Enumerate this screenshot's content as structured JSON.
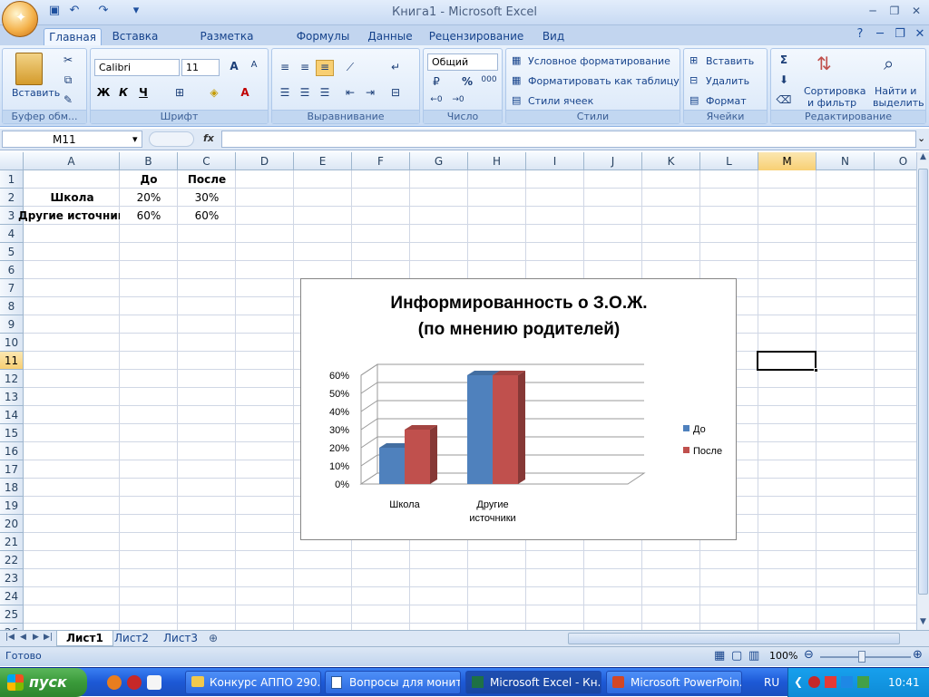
{
  "app": {
    "title": "Книга1 - Microsoft Excel"
  },
  "tabs": [
    "Главная",
    "Вставка",
    "Разметка страницы",
    "Формулы",
    "Данные",
    "Рецензирование",
    "Вид"
  ],
  "ribbon": {
    "clipboard": {
      "label": "Буфер обм...",
      "paste": "Вставить"
    },
    "font": {
      "label": "Шрифт",
      "name": "Calibri",
      "size": "11",
      "bold": "Ж",
      "italic": "К",
      "underline": "Ч",
      "grow": "A",
      "shrink": "A"
    },
    "alignment": {
      "label": "Выравнивание"
    },
    "number": {
      "label": "Число",
      "format": "Общий",
      "percent": "%",
      "thousands": "000"
    },
    "styles": {
      "label": "Стили",
      "conditional": "Условное форматирование",
      "as_table": "Форматировать как таблицу",
      "cell_styles": "Стили ячеек"
    },
    "cells": {
      "label": "Ячейки",
      "insert": "Вставить",
      "delete": "Удалить",
      "format": "Формат"
    },
    "editing": {
      "label": "Редактирование",
      "sort1": "Сортировка",
      "sort2": "и фильтр",
      "find1": "Найти и",
      "find2": "выделить"
    }
  },
  "namebox": "M11",
  "fx": "fx",
  "columns": [
    "A",
    "B",
    "C",
    "D",
    "E",
    "F",
    "G",
    "H",
    "I",
    "J",
    "K",
    "L",
    "M",
    "N",
    "O"
  ],
  "rows": [
    "1",
    "2",
    "3",
    "4",
    "5",
    "6",
    "7",
    "8",
    "9",
    "10",
    "11",
    "12",
    "13",
    "14",
    "15",
    "16",
    "17",
    "18",
    "19",
    "20",
    "21",
    "22",
    "23",
    "24",
    "25",
    "26"
  ],
  "cells": {
    "B1": "До",
    "C1": "После",
    "A2": "Школа",
    "B2": "20%",
    "C2": "30%",
    "A3": "Другие источники",
    "B3": "60%",
    "C3": "60%"
  },
  "chart_data": {
    "type": "bar",
    "title": "Информированность о З.О.Ж.",
    "subtitle": "(по мнению родителей)",
    "categories": [
      "Школа",
      "Другие источники"
    ],
    "category_lines": [
      [
        "Школа"
      ],
      [
        "Другие",
        "источники"
      ]
    ],
    "series": [
      {
        "name": "До",
        "values": [
          20,
          60
        ],
        "color": "#4f81bd"
      },
      {
        "name": "После",
        "values": [
          30,
          60
        ],
        "color": "#c0504d"
      }
    ],
    "yticks": [
      "0%",
      "10%",
      "20%",
      "30%",
      "40%",
      "50%",
      "60%"
    ],
    "ylim": [
      0,
      60
    ],
    "grid": true,
    "legend": "right"
  },
  "sheets": [
    "Лист1",
    "Лист2",
    "Лист3"
  ],
  "status": {
    "ready": "Готово",
    "zoom": "100%"
  },
  "taskbar": {
    "start": "пуск",
    "tasks": [
      "Конкурс АППО 290...",
      "Вопросы для монит...",
      "Microsoft Excel - Кн...",
      "Microsoft PowerPoin..."
    ],
    "lang": "RU",
    "clock": "10:41"
  },
  "colors": {
    "accent": "#15428b",
    "selection": "#f8cf73"
  }
}
